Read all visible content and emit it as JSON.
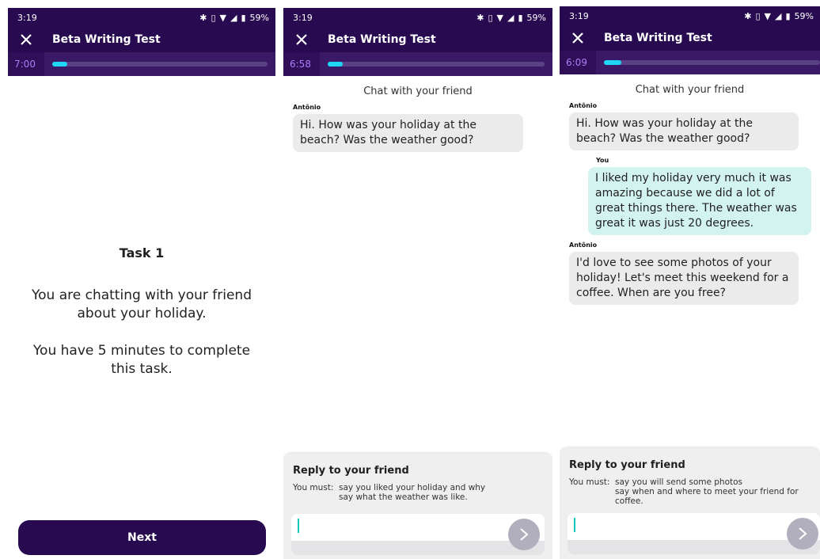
{
  "status": {
    "time": "3:19",
    "battery": "59%"
  },
  "app": {
    "title": "Beta Writing Test"
  },
  "screens": [
    {
      "timer": "7:00",
      "progress": 0.07
    },
    {
      "timer": "6:58",
      "progress": 0.07
    },
    {
      "timer": "6:09",
      "progress": 0.08
    }
  ],
  "task": {
    "title": "Task 1",
    "line1": "You are chatting with your friend about your holiday.",
    "line2": "You have 5 minutes to complete this task.",
    "next_label": "Next"
  },
  "chat": {
    "header": "Chat with your friend",
    "friend_name": "Antônio",
    "you_name": "You",
    "msg1": "Hi. How was your holiday at the beach? Was the weather good?",
    "reply_msg": "I liked my holiday very much it was amazing because we did a lot of great things there. The weather was great it was just 20 degrees.",
    "msg2": "I'd love to see some photos of your holiday! Let's meet this weekend for a coffee. When are you free?"
  },
  "reply": {
    "title": "Reply to your friend",
    "must_label": "You must:",
    "task1_points": [
      "say you liked your holiday and why",
      "say what the weather was like."
    ],
    "task2_points": [
      "say you will send some photos",
      "say when and where to meet your friend for coffee."
    ]
  },
  "colors": {
    "header": "#270a4f",
    "accent": "#1ed6f5",
    "you_bubble": "#d3f3f1",
    "friend_bubble": "#ebebeb"
  }
}
